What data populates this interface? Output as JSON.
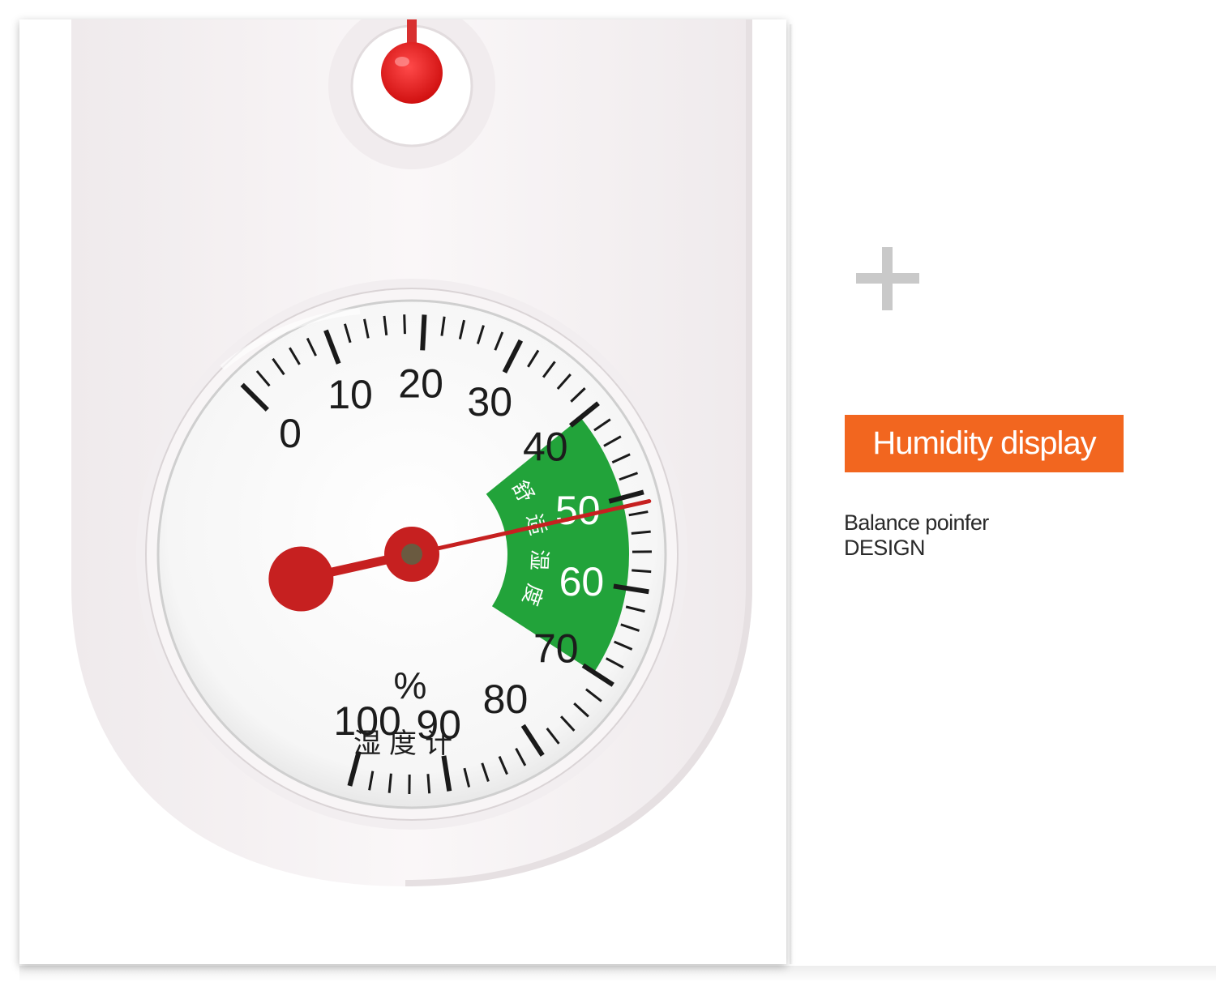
{
  "photo": {
    "dial_numbers": [
      "0",
      "10",
      "20",
      "30",
      "40",
      "50",
      "60",
      "70",
      "80",
      "90",
      "100"
    ],
    "unit": "%",
    "dial_label": "湿度计",
    "comfort_label": "舒适湿度",
    "pointer_reading_percent": 51,
    "comfort_zone_percent": [
      40,
      70
    ],
    "colors": {
      "comfort_zone": "#22a33a",
      "needle": "#c62020",
      "bulb": "#e21e1e",
      "body": "#f7f4f5"
    }
  },
  "decor": {
    "icon": "plus-icon"
  },
  "banner": {
    "title": "Humidity display",
    "color": "#f2661f"
  },
  "caption": {
    "line1": "Balance poinfer",
    "line2": "DESIGN"
  }
}
